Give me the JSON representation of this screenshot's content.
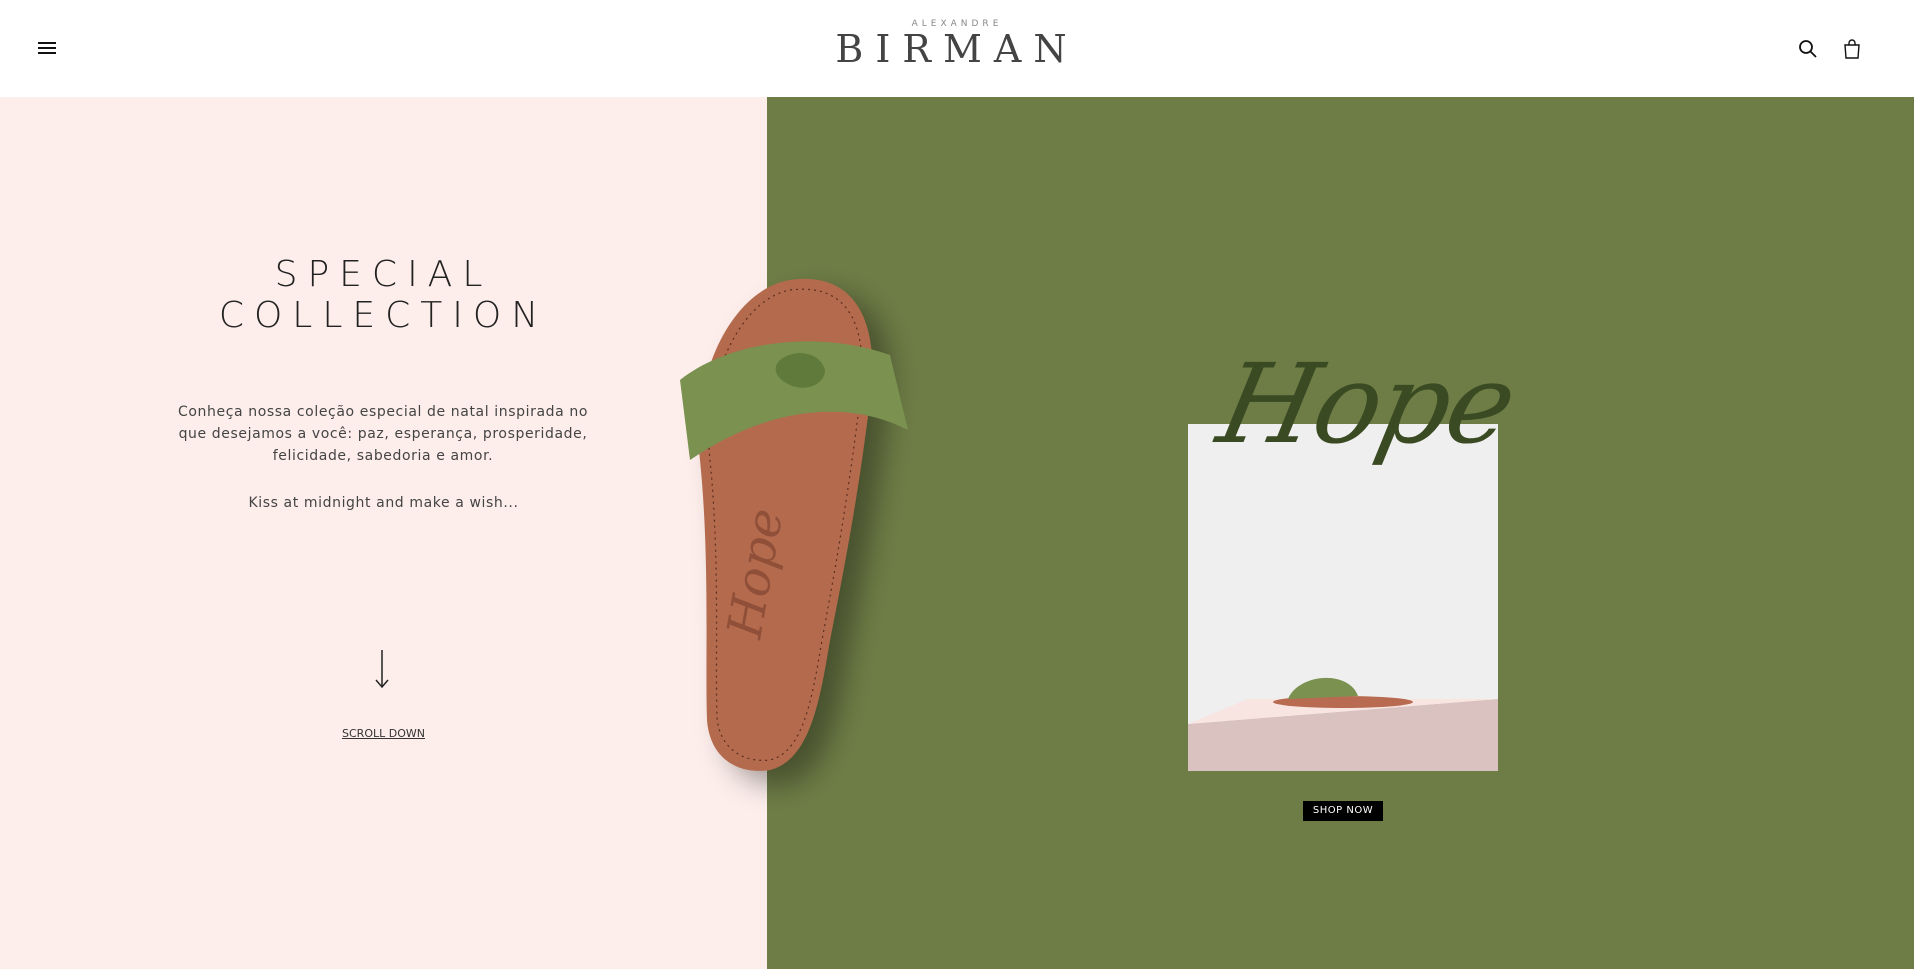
{
  "header": {
    "logo_small": "ALEXANDRE",
    "logo_big": "BIRMAN",
    "icons": [
      "menu-icon",
      "search-icon",
      "bag-icon"
    ]
  },
  "hero": {
    "title_line1": "SPECIAL",
    "title_line2": "COLLECTION",
    "description": "Conheça nossa coleção especial de natal inspirada no que desejamos a você: paz, esperança, prosperidade, felicidade, sabedoria e amor.",
    "tagline": "Kiss at midnight and make a wish...",
    "scroll_label": "SCROLL DOWN"
  },
  "product": {
    "script_title": "Hope",
    "shop_button": "SHOP NOW"
  },
  "colors": {
    "left_bg": "#fdeeeb",
    "right_bg": "#6e7c46",
    "strap_green": "#7a9150",
    "sole_brown": "#b46a4e"
  }
}
